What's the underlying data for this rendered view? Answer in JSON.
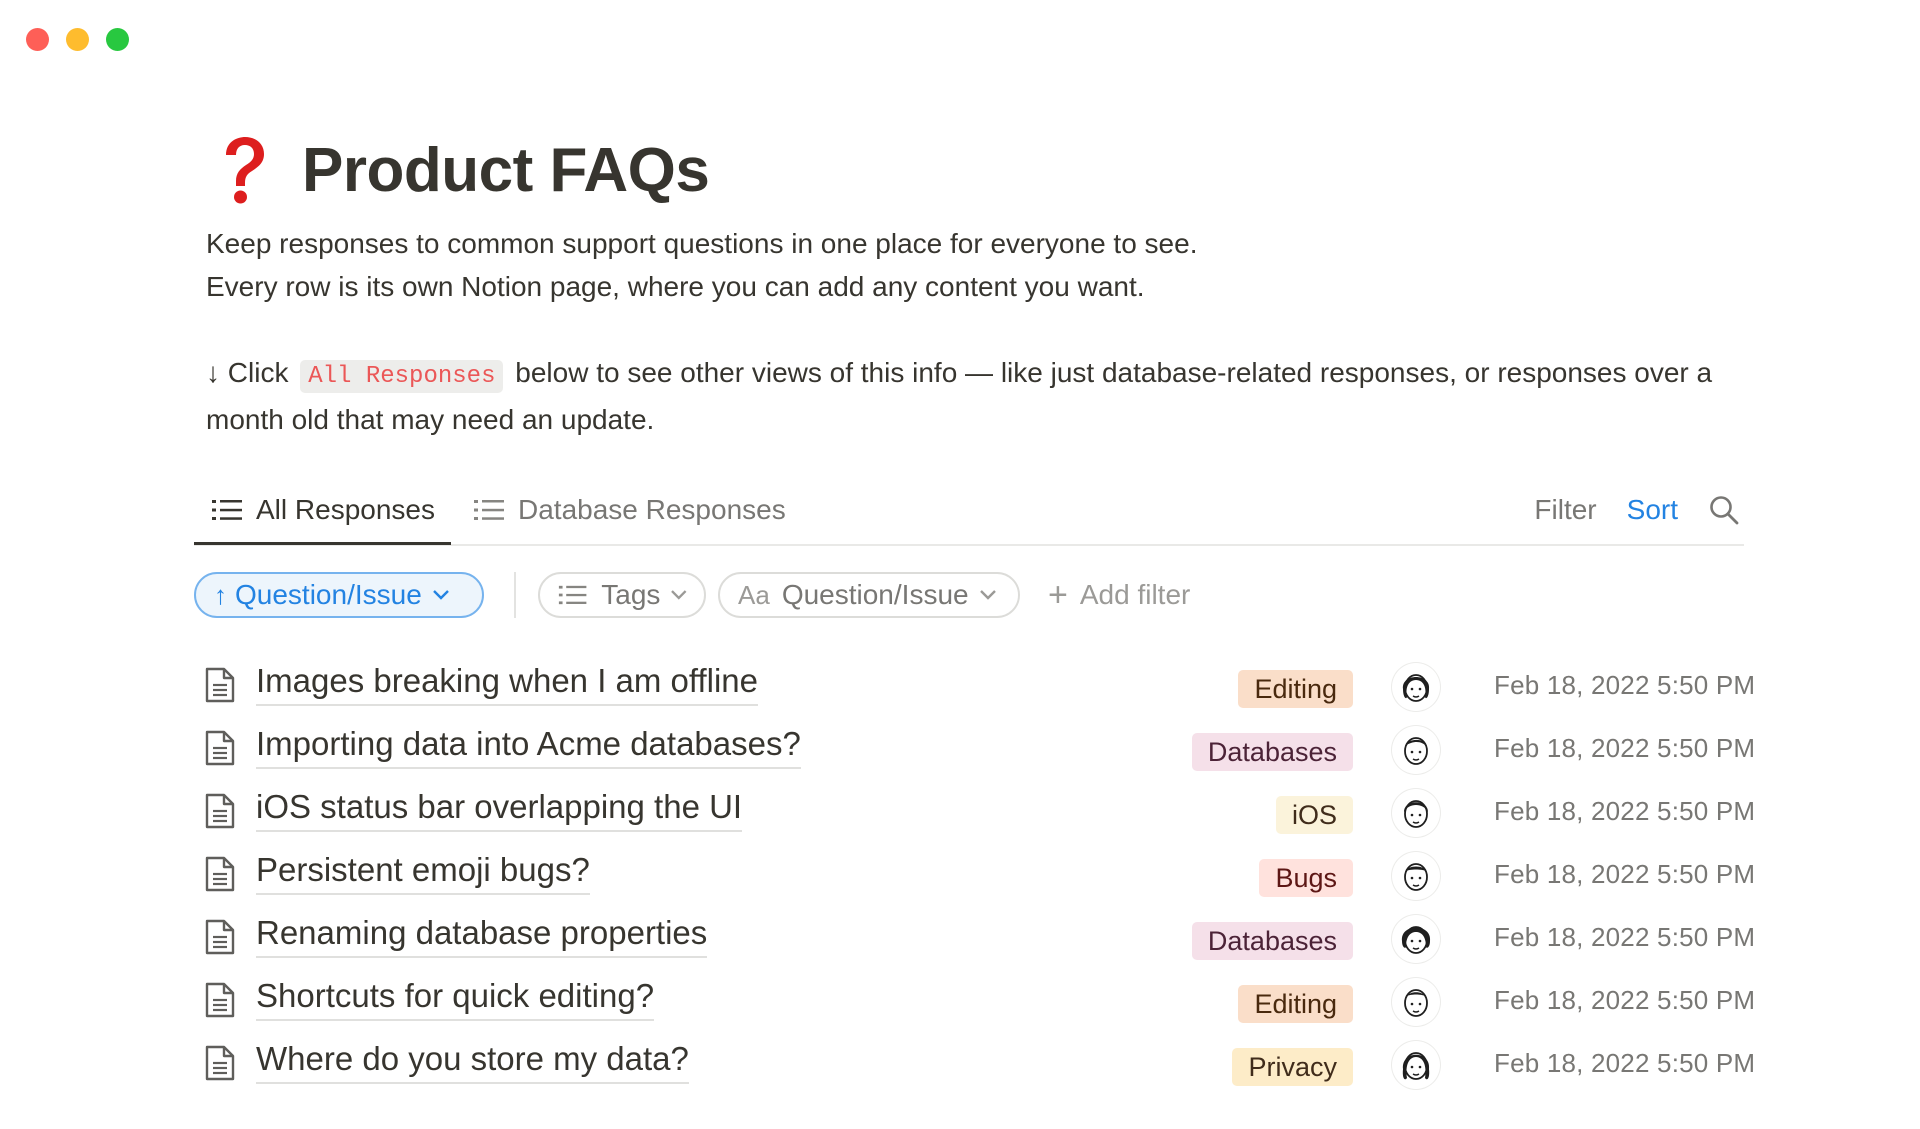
{
  "page": {
    "title": "Product FAQs",
    "emoji": "question-mark-emoji",
    "desc_line1": "Keep responses to common support questions in one place for everyone to see.",
    "desc_line2": "Every row is its own Notion page, where you can add any content you want.",
    "desc_click_prefix": "↓ Click",
    "desc_click_code": "All Responses",
    "desc_click_suffix": "below to see other views of this info — like just database-related responses, or responses over a month old that may need an update."
  },
  "views": {
    "active_label": "All Responses",
    "inactive_label": "Database Responses",
    "filter_label": "Filter",
    "sort_label": "Sort"
  },
  "filters": {
    "sort_pill": "Question/Issue",
    "tags_pill": "Tags",
    "question_pill_prefix": "Aa",
    "question_pill": "Question/Issue",
    "add_filter": "Add filter"
  },
  "colors": {
    "accent": "#2383e2",
    "tag_editing": "#fadec9",
    "tag_databases": "#f5e0e9",
    "tag_ios": "#fbf3db",
    "tag_bugs": "#ffe2dd",
    "tag_privacy": "#fdecc8"
  },
  "rows": [
    {
      "title": "Images breaking when I am offline",
      "tag": "Editing",
      "tag_bg": "#fadec9",
      "tag_fg": "#49290e",
      "date": "Feb 18, 2022 5:50 PM",
      "avatar": "person-avatar-1"
    },
    {
      "title": "Importing data into Acme databases?",
      "tag": "Databases",
      "tag_bg": "#f5e0e9",
      "tag_fg": "#4c2337",
      "date": "Feb 18, 2022 5:50 PM",
      "avatar": "person-avatar-2"
    },
    {
      "title": "iOS status bar overlapping the UI",
      "tag": "iOS",
      "tag_bg": "#fbf3db",
      "tag_fg": "#402c1b",
      "date": "Feb 18, 2022 5:50 PM",
      "avatar": "person-avatar-3"
    },
    {
      "title": "Persistent emoji bugs?",
      "tag": "Bugs",
      "tag_bg": "#ffe2dd",
      "tag_fg": "#5d1715",
      "date": "Feb 18, 2022 5:50 PM",
      "avatar": "person-avatar-4"
    },
    {
      "title": "Renaming database properties",
      "tag": "Databases",
      "tag_bg": "#f5e0e9",
      "tag_fg": "#4c2337",
      "date": "Feb 18, 2022 5:50 PM",
      "avatar": "person-avatar-5"
    },
    {
      "title": "Shortcuts for quick editing?",
      "tag": "Editing",
      "tag_bg": "#fadec9",
      "tag_fg": "#49290e",
      "date": "Feb 18, 2022 5:50 PM",
      "avatar": "person-avatar-6"
    },
    {
      "title": "Where do you store my data?",
      "tag": "Privacy",
      "tag_bg": "#fdecc8",
      "tag_fg": "#402c1b",
      "date": "Feb 18, 2022 5:50 PM",
      "avatar": "person-avatar-7"
    }
  ]
}
